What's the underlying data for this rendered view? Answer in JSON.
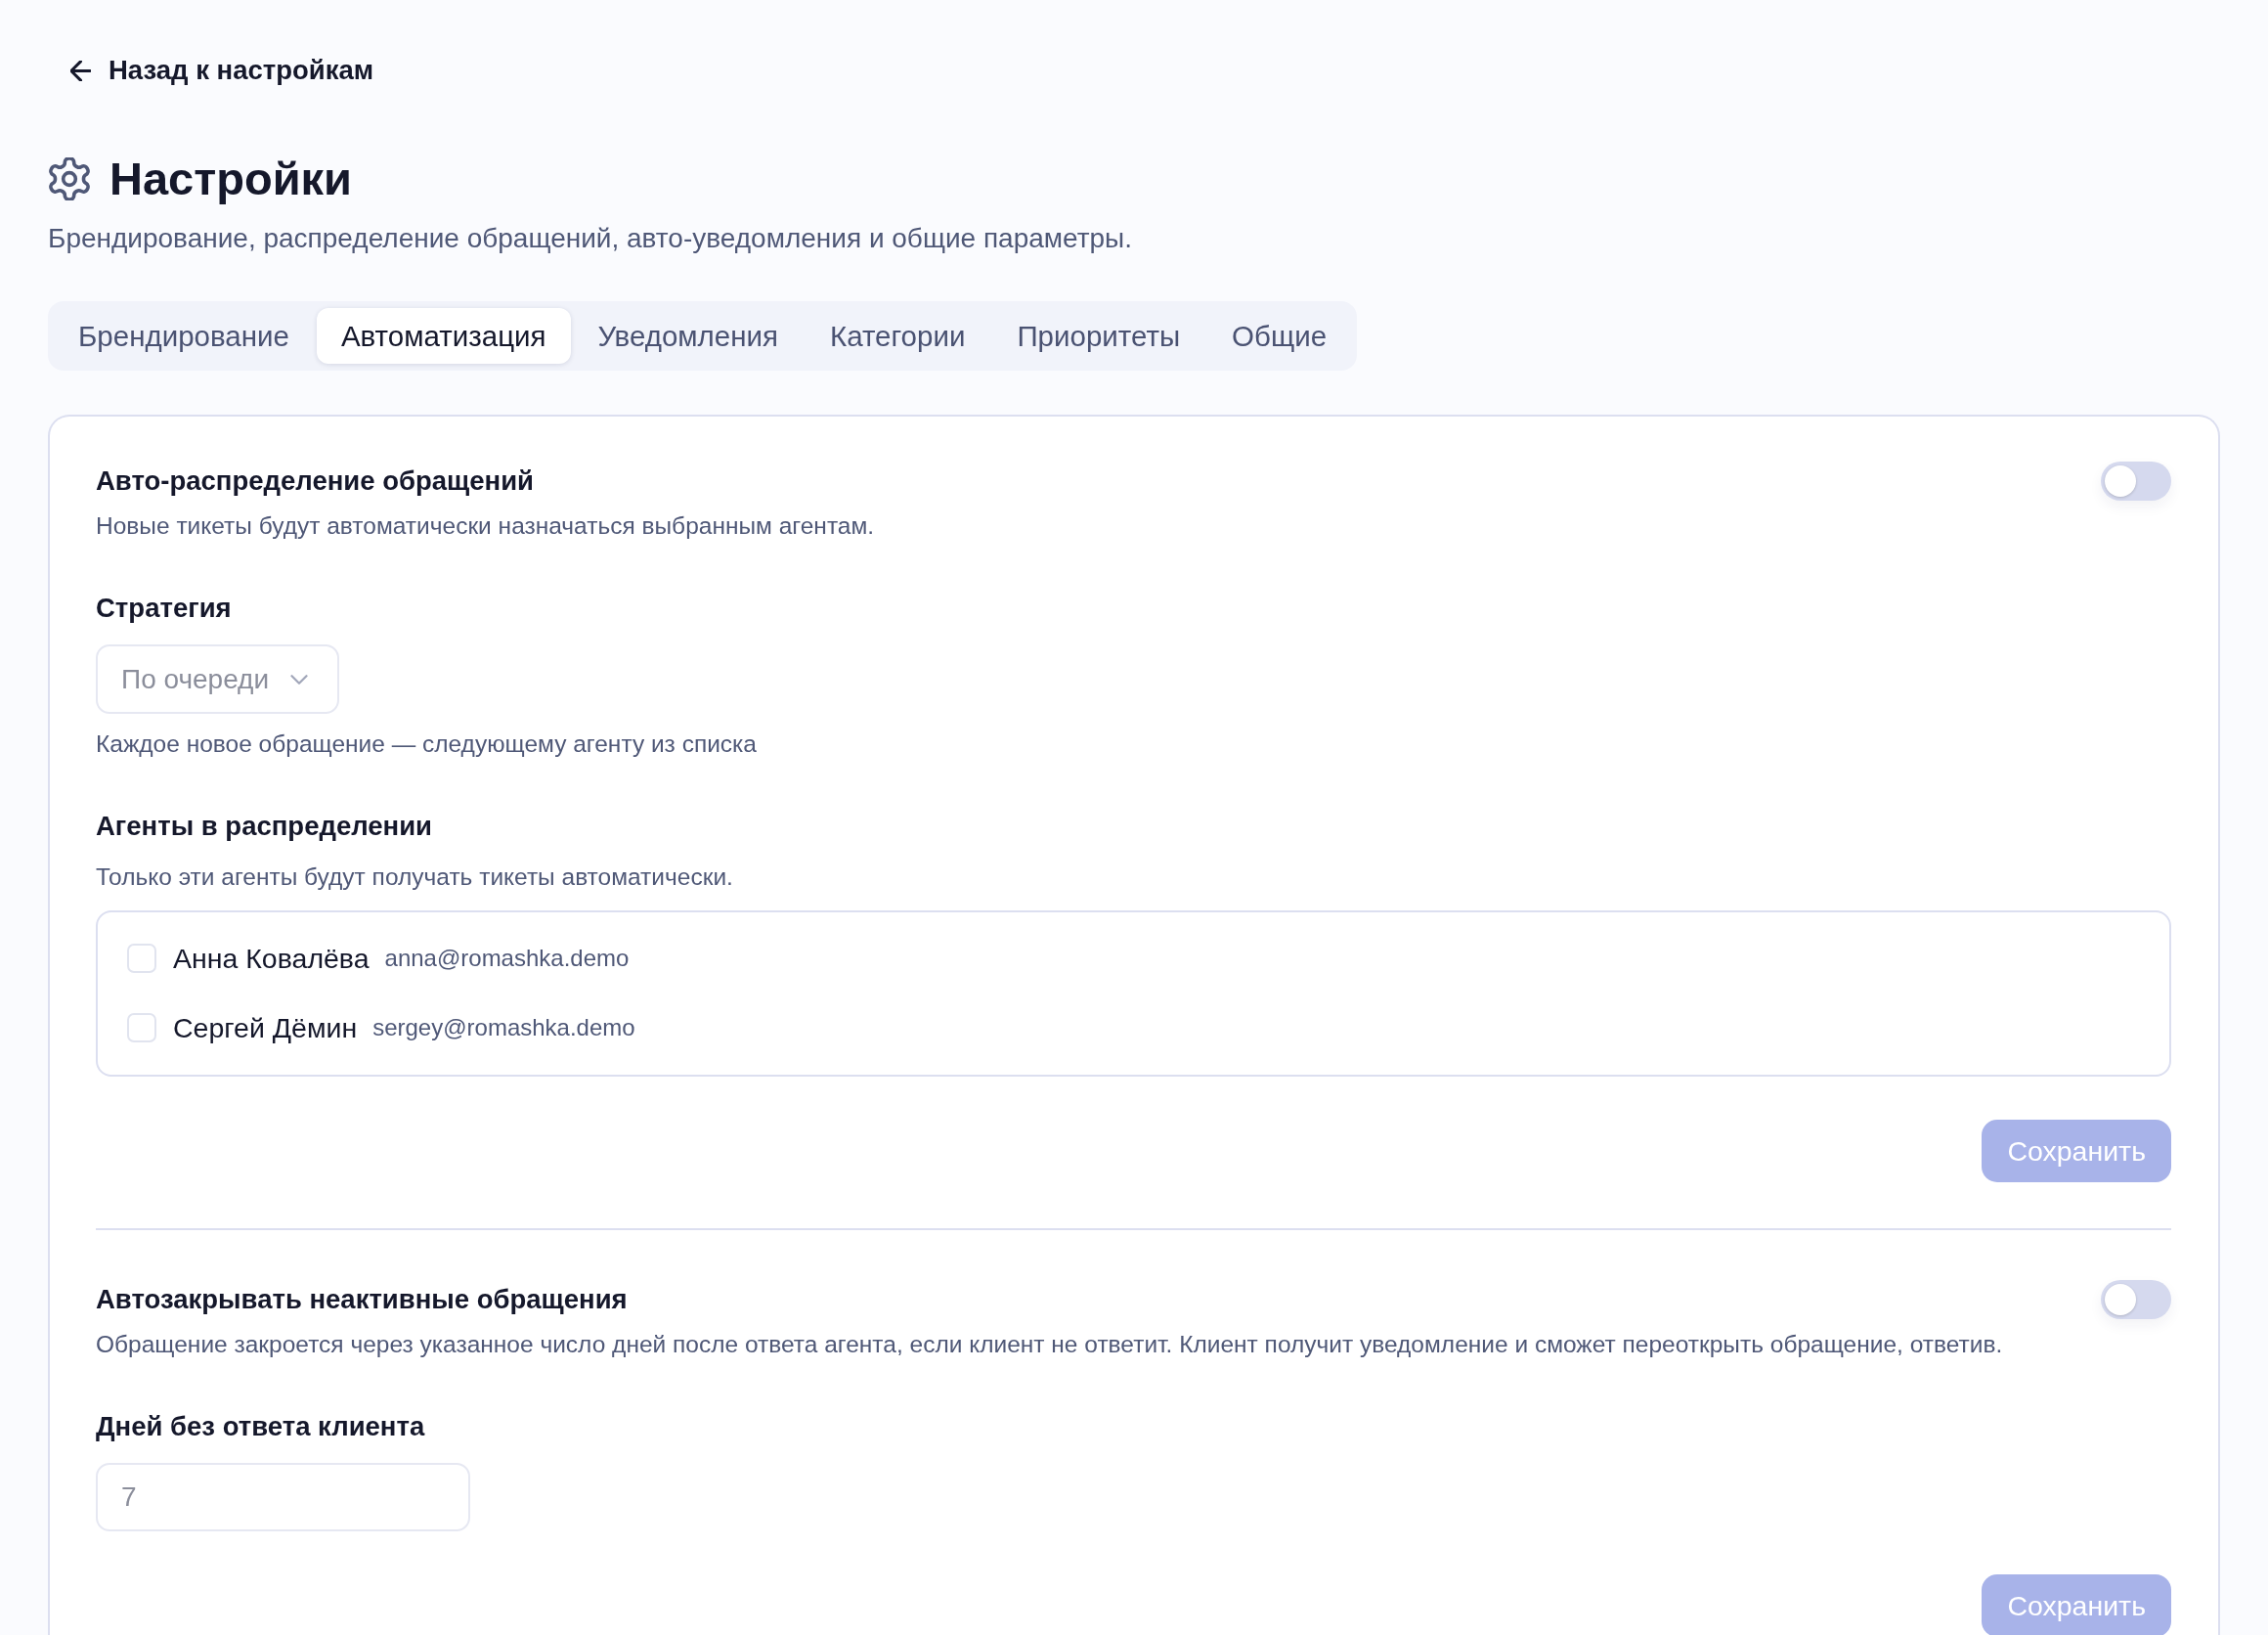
{
  "back_link": {
    "label": "Назад к настройкам"
  },
  "header": {
    "title": "Настройки",
    "subtitle": "Брендирование, распределение обращений, авто-уведомления и общие параметры."
  },
  "tabs": [
    {
      "label": "Брендирование",
      "selected": false
    },
    {
      "label": "Автоматизация",
      "selected": true
    },
    {
      "label": "Уведомления",
      "selected": false
    },
    {
      "label": "Категории",
      "selected": false
    },
    {
      "label": "Приоритеты",
      "selected": false
    },
    {
      "label": "Общие",
      "selected": false
    }
  ],
  "sections": [
    {
      "title": "Авто-распределение обращений",
      "description": "Новые тикеты будут автоматически назначаться выбранным агентам.",
      "on": false,
      "fields": [
        {
          "kind": "select",
          "label": "Стратегия",
          "value": "По очереди",
          "disabled": true,
          "hint": "Каждое новое обращение — следующему агенту из списка"
        },
        {
          "kind": "checklist",
          "label": "Агенты в распределении",
          "description": "Только эти агенты будут получать тикеты автоматически.",
          "items": [
            {
              "name": "Анна Ковалёва",
              "email": "anna@romashka.demo",
              "checked": false
            },
            {
              "name": "Сергей Дёмин",
              "email": "sergey@romashka.demo",
              "checked": false
            }
          ]
        }
      ],
      "save_button": {
        "label": "Сохранить",
        "disabled": true
      }
    },
    {
      "title": "Автозакрывать неактивные обращения",
      "description": "Обращение закроется через указанное число дней после ответа агента, если клиент не ответит. Клиент получит уведомление и сможет переоткрыть обращение, ответив.",
      "on": false,
      "fields": [
        {
          "kind": "number",
          "label": "Дней без ответа клиента",
          "value": "7",
          "disabled": true
        }
      ],
      "save_button": {
        "label": "Сохранить",
        "disabled": true
      }
    }
  ]
}
